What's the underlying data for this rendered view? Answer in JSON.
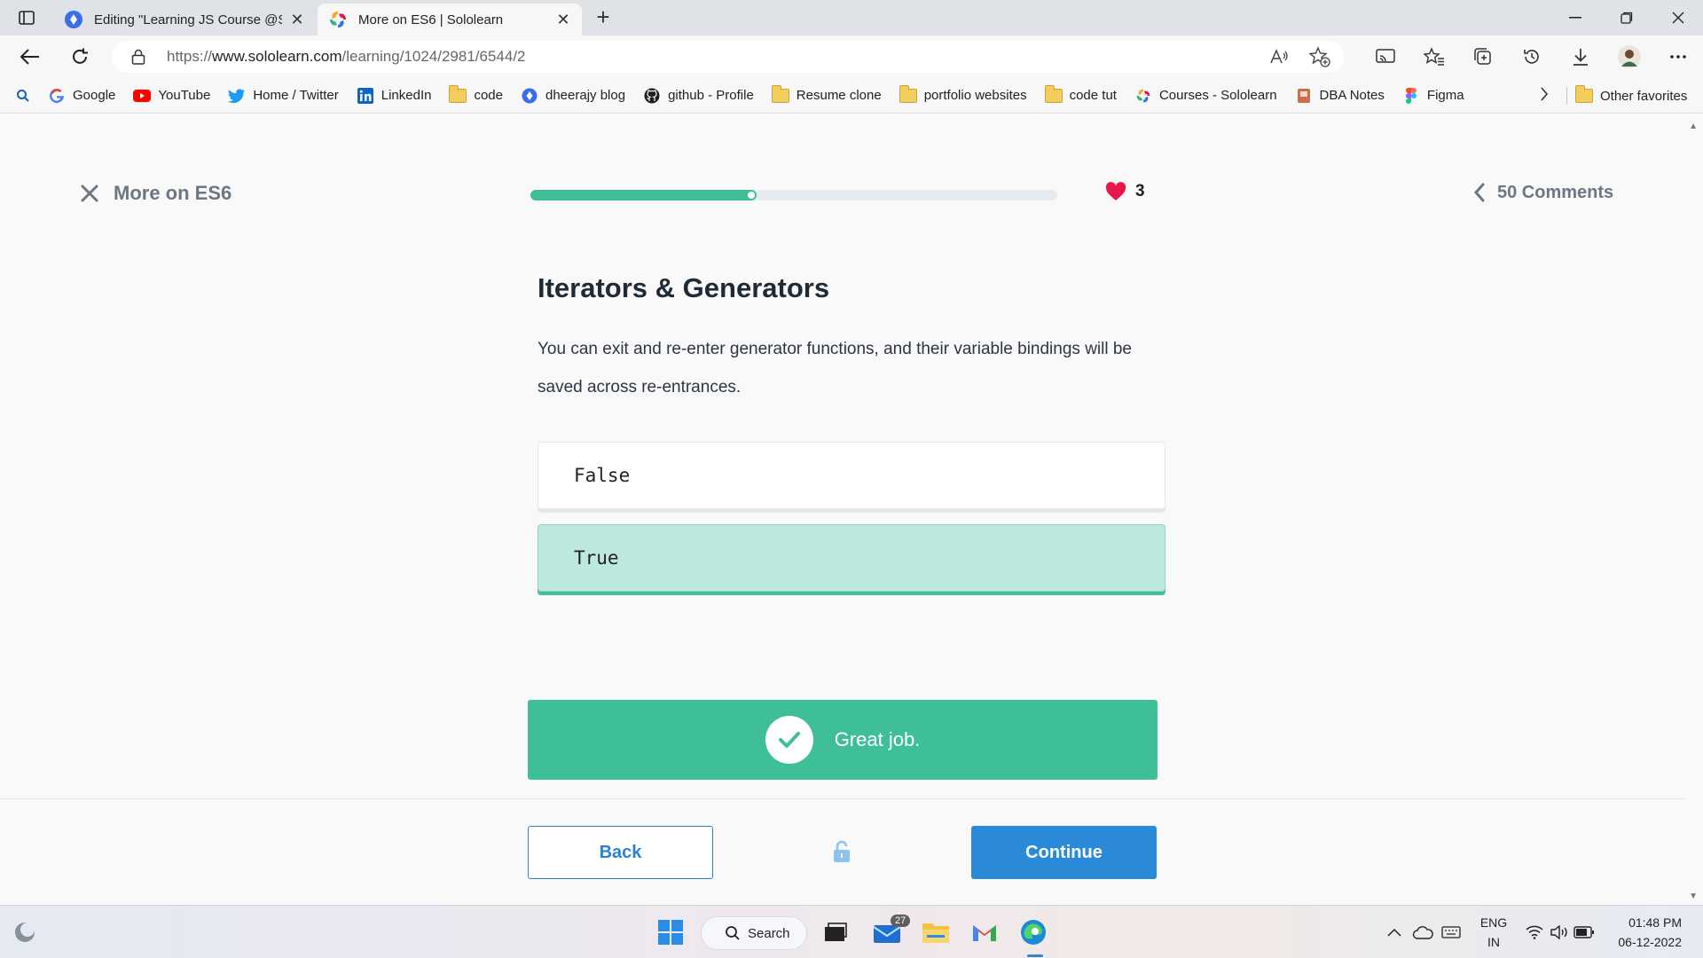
{
  "browser": {
    "tabs": [
      {
        "title": "Editing \"Learning JS Course @Sololearn\"",
        "active": false
      },
      {
        "title": "More on ES6 | Sololearn",
        "active": true
      }
    ],
    "url_prefix": "https://",
    "url_main": "www.sololearn.com",
    "url_path": "/learning/1024/2981/6544/2",
    "favorites": [
      {
        "label": "Google",
        "icon": "google-icon"
      },
      {
        "label": "YouTube",
        "icon": "youtube-icon"
      },
      {
        "label": "Home / Twitter",
        "icon": "twitter-icon"
      },
      {
        "label": "LinkedIn",
        "icon": "linkedin-icon"
      },
      {
        "label": "code",
        "icon": "folder-icon"
      },
      {
        "label": "dheerajy blog",
        "icon": "blog-icon"
      },
      {
        "label": "github - Profile",
        "icon": "github-icon"
      },
      {
        "label": "Resume clone",
        "icon": "folder-icon"
      },
      {
        "label": "portfolio websites",
        "icon": "folder-icon"
      },
      {
        "label": "code tut",
        "icon": "folder-icon"
      },
      {
        "label": "Courses - Sololearn",
        "icon": "sololearn-icon"
      },
      {
        "label": "DBA Notes",
        "icon": "notes-icon"
      },
      {
        "label": "Figma",
        "icon": "figma-icon"
      }
    ],
    "other_favorites": "Other favorites"
  },
  "lesson": {
    "title": "More on ES6",
    "progress": 0.43,
    "lives": "3",
    "comments": "50 Comments"
  },
  "question": {
    "title": "Iterators & Generators",
    "text": "You can exit and re-enter generator functions, and their variable bindings will be saved across re-entrances.",
    "options": [
      {
        "label": "False",
        "selected": false
      },
      {
        "label": "True",
        "selected": true
      }
    ]
  },
  "feedback": {
    "message": "Great job."
  },
  "footer": {
    "back_label": "Back",
    "continue_label": "Continue"
  },
  "colors": {
    "accent_green": "#3fbf97",
    "accent_blue": "#2b8ad7",
    "heart": "#e8174a"
  },
  "taskbar": {
    "search_label": "Search",
    "mail_badge": "27",
    "lang_line1": "ENG",
    "lang_line2": "IN",
    "time": "01:48 PM",
    "date": "06-12-2022"
  }
}
